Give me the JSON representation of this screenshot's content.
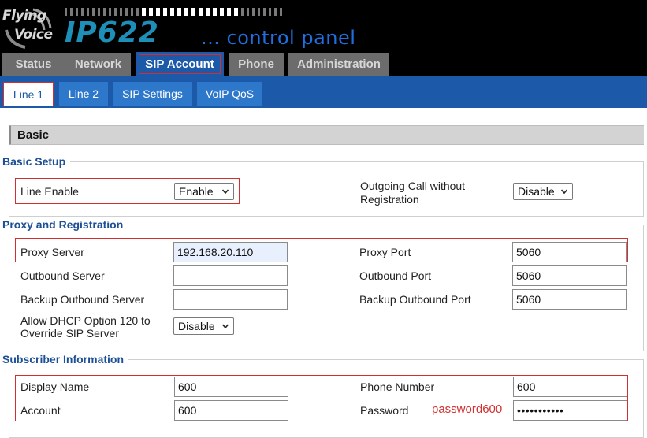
{
  "brand": {
    "logo_line1": "Flying",
    "logo_line2": "Voice",
    "model": "IP622",
    "tagline": "... control panel"
  },
  "main_tabs": [
    {
      "label": "Status"
    },
    {
      "label": "Network"
    },
    {
      "label": "SIP Account"
    },
    {
      "label": "Phone"
    },
    {
      "label": "Administration"
    }
  ],
  "sub_tabs": [
    {
      "label": "Line 1"
    },
    {
      "label": "Line 2"
    },
    {
      "label": "SIP Settings"
    },
    {
      "label": "VoIP QoS"
    }
  ],
  "basic": {
    "title": "Basic"
  },
  "basic_setup": {
    "title": "Basic Setup",
    "line_enable_label": "Line Enable",
    "line_enable_value": "Enable",
    "outgoing_label_1": "Outgoing Call without",
    "outgoing_label_2": "Registration",
    "outgoing_value": "Disable"
  },
  "proxy": {
    "title": "Proxy and Registration",
    "proxy_server_label": "Proxy Server",
    "proxy_server_value": "192.168.20.110",
    "proxy_port_label": "Proxy Port",
    "proxy_port_value": "5060",
    "outbound_server_label": "Outbound Server",
    "outbound_server_value": "",
    "outbound_port_label": "Outbound Port",
    "outbound_port_value": "5060",
    "backup_server_label": "Backup Outbound Server",
    "backup_server_value": "",
    "backup_port_label": "Backup Outbound Port",
    "backup_port_value": "5060",
    "dhcp_label_1": "Allow DHCP Option 120 to",
    "dhcp_label_2": "Override SIP Server",
    "dhcp_value": "Disable"
  },
  "subscriber": {
    "title": "Subscriber Information",
    "display_name_label": "Display Name",
    "display_name_value": "600",
    "phone_number_label": "Phone Number",
    "phone_number_value": "600",
    "account_label": "Account",
    "account_value": "600",
    "password_label": "Password",
    "password_hint": "password600",
    "password_masked": "•••••••••••"
  }
}
